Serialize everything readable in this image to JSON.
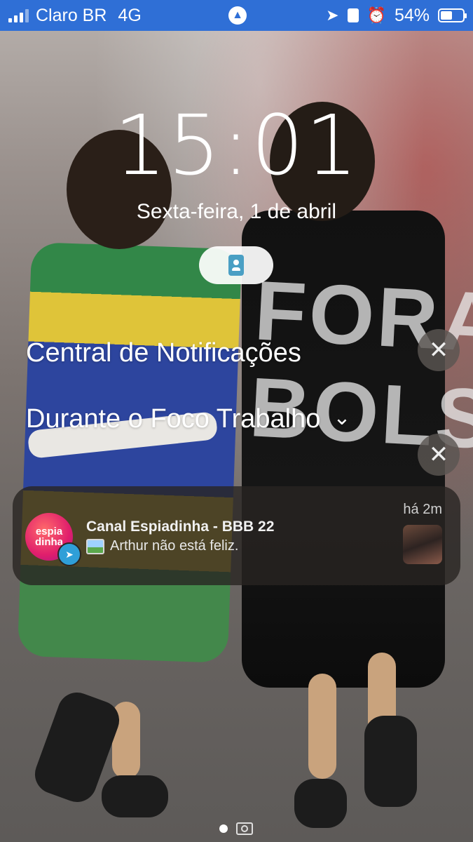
{
  "status_bar": {
    "carrier": "Claro BR",
    "network": "4G",
    "battery": "54%",
    "battery_level": 0.54,
    "icons": [
      "location-arrow-icon",
      "id-badge-icon",
      "alarm-icon"
    ]
  },
  "lock_screen": {
    "time": "15:01",
    "date": "Sexta-feira, 1 de abril",
    "focus_icon": "id-badge-icon"
  },
  "sections": {
    "notification_center": "Central de Notificações",
    "focus_section": "Durante o Foco Trabalho",
    "close_glyph": "✕",
    "chevron_glyph": "⌄"
  },
  "notification": {
    "app_icon_text": "espia dinha",
    "title": "Canal Espiadinha - BBB 22",
    "body": "Arthur não está feliz.",
    "time": "há 2m",
    "badge_icon": "telegram-icon"
  },
  "wallpaper": {
    "cloak_text": "FORA BOLSONARO"
  },
  "colors": {
    "status_bar": "#2f6fd6",
    "notification_bg": "#282422",
    "close_button_bg": "#5a5552"
  }
}
